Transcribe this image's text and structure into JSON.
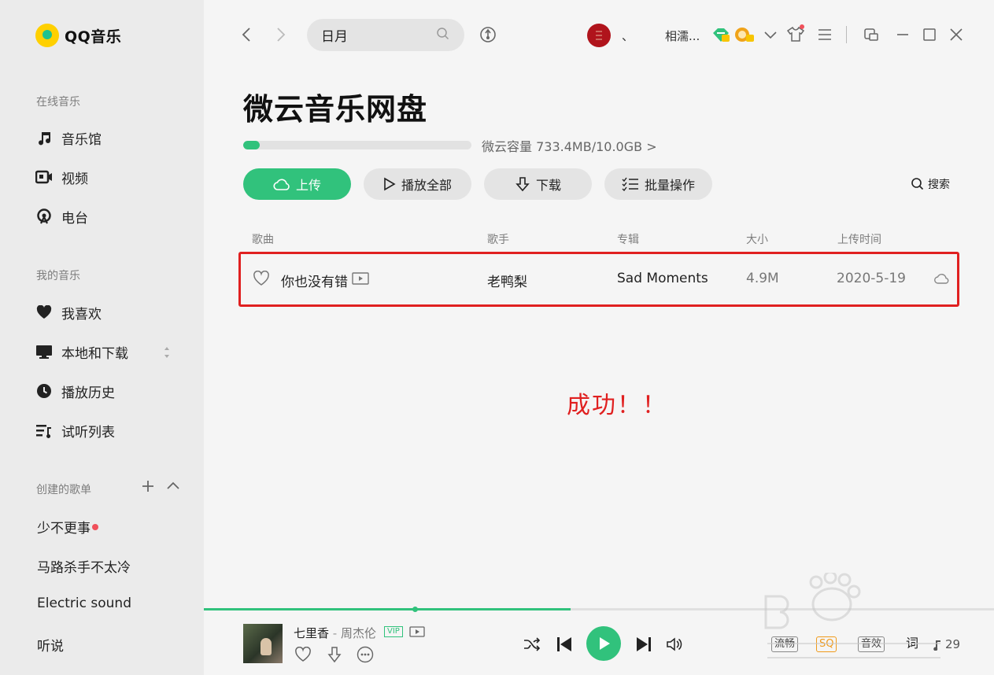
{
  "app": {
    "logo_text": "QQ音乐"
  },
  "sidebar": {
    "online_title": "在线音乐",
    "online_items": [
      {
        "label": "音乐馆",
        "icon": "music-note-icon"
      },
      {
        "label": "视频",
        "icon": "video-icon"
      },
      {
        "label": "电台",
        "icon": "radio-icon"
      }
    ],
    "mine_title": "我的音乐",
    "mine_items": [
      {
        "label": "我喜欢",
        "icon": "heart-icon"
      },
      {
        "label": "本地和下载",
        "icon": "monitor-icon"
      },
      {
        "label": "播放历史",
        "icon": "clock-icon"
      },
      {
        "label": "试听列表",
        "icon": "playlist-icon"
      }
    ],
    "created_title": "创建的歌单",
    "playlists": [
      "少不更事",
      "马路杀手不太冷",
      "Electric sound",
      "听说"
    ]
  },
  "topbar": {
    "search_value": "日月",
    "separator": "、",
    "username": "相濡..."
  },
  "main": {
    "title": "微云音乐网盘",
    "storage_label": "微云容量",
    "storage_value": "733.4MB/10.0GB",
    "storage_arrow": ">",
    "storage_fraction": 0.072,
    "buttons": {
      "upload": "上传",
      "play_all": "播放全部",
      "download": "下载",
      "batch": "批量操作",
      "search": "搜索"
    },
    "columns": {
      "song": "歌曲",
      "artist": "歌手",
      "album": "专辑",
      "size": "大小",
      "upload_time": "上传时间"
    },
    "song": {
      "title": "你也没有错",
      "artist": "老鸭梨",
      "album": "Sad Moments",
      "size": "4.9M",
      "upload_time": "2020-5-19"
    },
    "annotation": "成功！！"
  },
  "player": {
    "song_title": "七里香",
    "separator": "-",
    "artist": "周杰伦",
    "vip_badge": "VIP",
    "progress_fraction": 0.464,
    "quality_1": "流畅",
    "quality_2": "SQ",
    "quality_3": "音效",
    "lyrics_label": "词",
    "playlist_count": "29"
  },
  "colors": {
    "accent": "#31c27c",
    "annotation": "#e02020",
    "sidebar_bg": "#ebebeb",
    "main_bg": "#f5f5f5"
  }
}
